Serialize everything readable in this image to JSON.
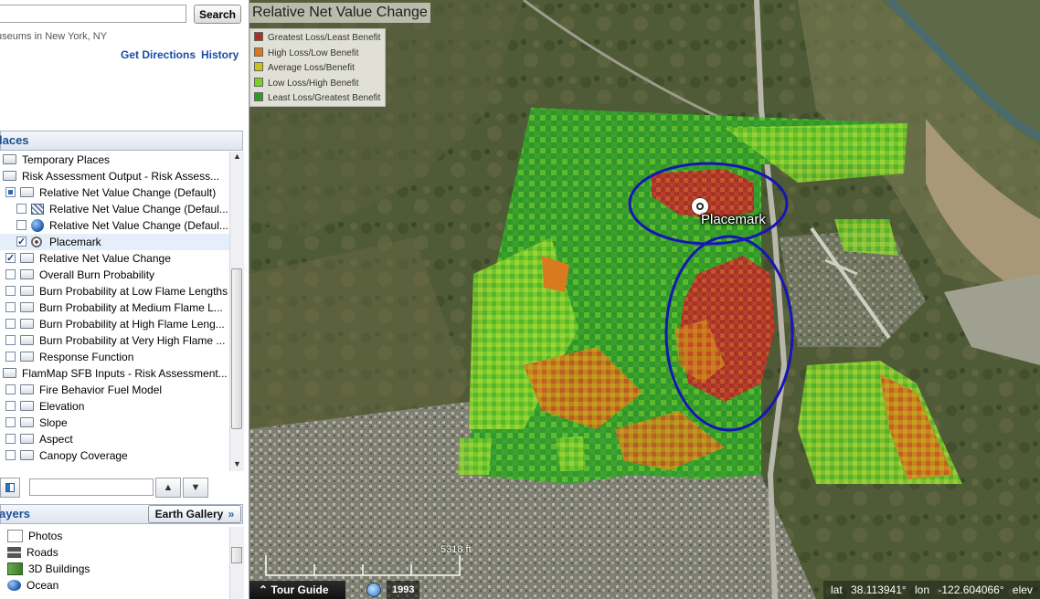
{
  "search": {
    "input_value": "",
    "button_label": "Search",
    "hint": "useums in New York, NY",
    "get_directions": "Get Directions",
    "history": "History"
  },
  "places": {
    "header": "laces",
    "items": [
      {
        "label": "Temporary Places",
        "checkbox": "none",
        "icon": "folder-icon"
      },
      {
        "label": "Risk Assessment Output - Risk Assess...",
        "checkbox": "none",
        "icon": "folder-icon"
      },
      {
        "label": "Relative Net Value Change (Default)",
        "checkbox": "partial",
        "icon": "folder-icon"
      },
      {
        "label": "Relative Net Value Change (Defaul...",
        "checkbox": "unchecked",
        "icon": "ground-overlay-icon"
      },
      {
        "label": "Relative Net Value Change (Defaul...",
        "checkbox": "unchecked",
        "icon": "globe-icon"
      },
      {
        "label": "Placemark",
        "checkbox": "checked",
        "icon": "placemark-icon"
      },
      {
        "label": "Relative Net Value Change",
        "checkbox": "checked",
        "icon": "folder-icon"
      },
      {
        "label": "Overall Burn Probability",
        "checkbox": "unchecked",
        "icon": "folder-icon"
      },
      {
        "label": "Burn Probability at Low Flame Lengths",
        "checkbox": "unchecked",
        "icon": "folder-icon"
      },
      {
        "label": "Burn Probability at Medium Flame L...",
        "checkbox": "unchecked",
        "icon": "folder-icon"
      },
      {
        "label": "Burn Probability at High Flame Leng...",
        "checkbox": "unchecked",
        "icon": "folder-icon"
      },
      {
        "label": "Burn Probability at Very High Flame ...",
        "checkbox": "unchecked",
        "icon": "folder-icon"
      },
      {
        "label": "Response Function",
        "checkbox": "unchecked",
        "icon": "folder-icon"
      },
      {
        "label": "FlamMap SFB Inputs - Risk Assessment...",
        "checkbox": "none",
        "icon": "folder-icon"
      },
      {
        "label": "Fire Behavior Fuel Model",
        "checkbox": "unchecked",
        "icon": "folder-icon"
      },
      {
        "label": "Elevation",
        "checkbox": "unchecked",
        "icon": "folder-icon"
      },
      {
        "label": "Slope",
        "checkbox": "unchecked",
        "icon": "folder-icon"
      },
      {
        "label": "Aspect",
        "checkbox": "unchecked",
        "icon": "folder-icon"
      },
      {
        "label": "Canopy Coverage",
        "checkbox": "unchecked",
        "icon": "folder-icon"
      }
    ],
    "filter_value": ""
  },
  "layers": {
    "header": "ayers",
    "earth_gallery_label": "Earth Gallery",
    "earth_gallery_chevron": "»",
    "items": [
      {
        "label": "Photos",
        "icon": "photos-icon"
      },
      {
        "label": "Roads",
        "icon": "roads-icon"
      },
      {
        "label": "3D Buildings",
        "icon": "buildings-icon"
      },
      {
        "label": "Ocean",
        "icon": "ocean-icon"
      }
    ]
  },
  "map": {
    "legend_title": "Relative Net Value Change",
    "legend": [
      {
        "label": "Greatest Loss/Least Benefit",
        "color": "#a83228"
      },
      {
        "label": "High Loss/Low Benefit",
        "color": "#d97a1e"
      },
      {
        "label": "Average Loss/Benefit",
        "color": "#c9c21b"
      },
      {
        "label": "Low Loss/High Benefit",
        "color": "#7ccf2a"
      },
      {
        "label": "Least Loss/Greatest Benefit",
        "color": "#2f9a2a"
      }
    ],
    "placemark_label": "Placemark",
    "scale_label": "5318 ft",
    "tour_guide_label": "Tour Guide",
    "tour_guide_chevron": "⌃",
    "imagery_year": "1993",
    "status": {
      "lat_label": "lat",
      "lat_value": "38.113941°",
      "lon_label": "lon",
      "lon_value": "-122.604066°",
      "elev_label": "elev"
    }
  }
}
